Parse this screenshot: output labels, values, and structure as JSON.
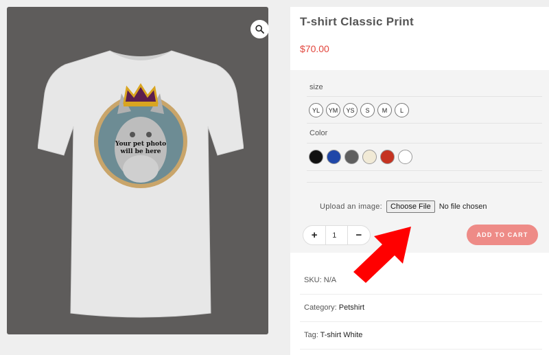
{
  "product": {
    "title": "T-shirt Classic Print",
    "price": "$70.00",
    "print_text_line1": "Your pet photo",
    "print_text_line2": "will be here"
  },
  "icons": {
    "zoom": "search-icon"
  },
  "variations": {
    "size_label": "size",
    "sizes": [
      "YL",
      "YM",
      "YS",
      "S",
      "M",
      "L"
    ],
    "color_label": "Color",
    "colors": [
      "#111111",
      "#1f47a8",
      "#5f5f5f",
      "#f1ead6",
      "#c53321",
      "#ffffff"
    ]
  },
  "upload": {
    "label": "Upload an image:",
    "button": "Choose File",
    "status": "No file chosen"
  },
  "cart": {
    "minus": "−",
    "plus": "+",
    "quantity": "1",
    "add_label": "ADD TO CART"
  },
  "meta": {
    "sku_label": "SKU:",
    "sku_value": "N/A",
    "category_label": "Category:",
    "category_value": "Petshirt",
    "tag_label": "Tag:",
    "tag_value": "T-shirt White"
  },
  "colors": {
    "accent": "#e2453c",
    "button": "#ee8b87",
    "arrow": "#ff0000"
  }
}
